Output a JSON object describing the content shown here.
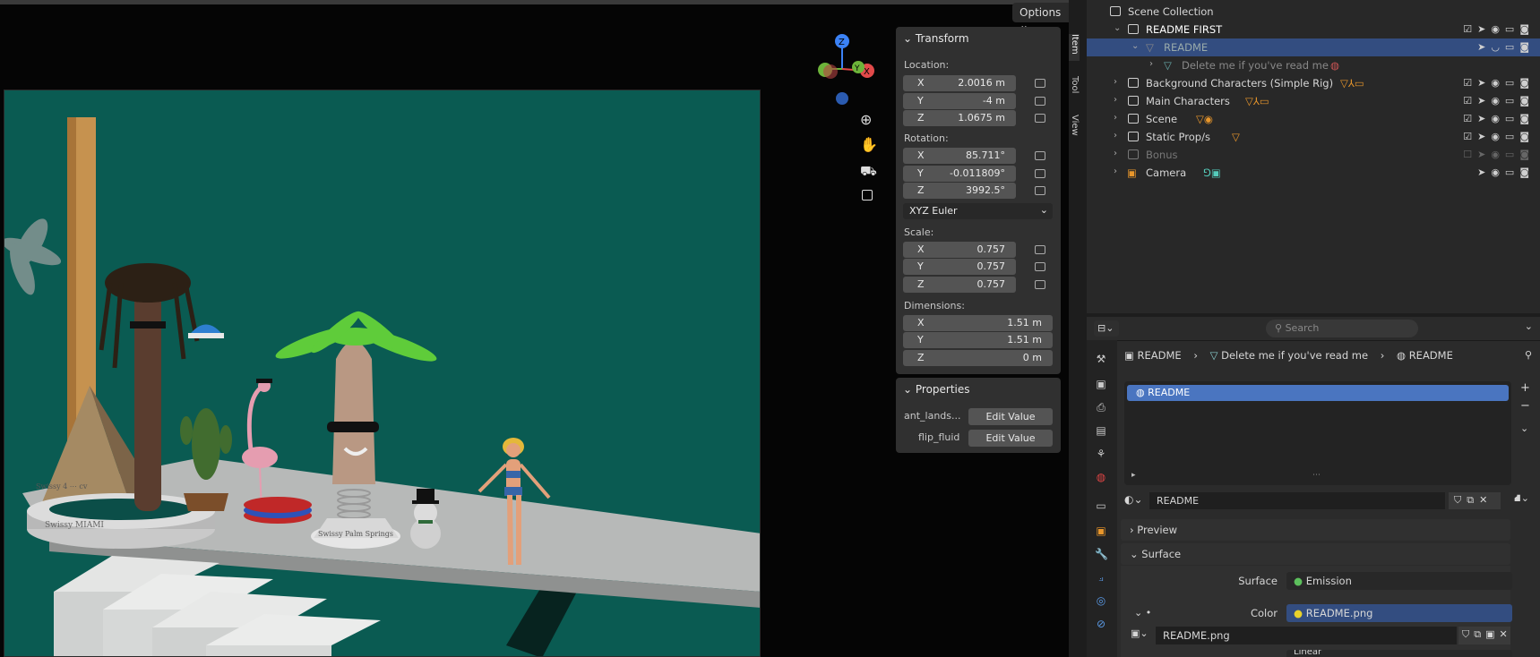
{
  "viewport": {
    "options_label": "Options ⌄",
    "text_art_1": "Swissy 4 ⋯ cv",
    "text_art_2": "Swissy MIAMI",
    "text_art_3": "Swissy Palm Springs",
    "tabs": [
      "Item",
      "Tool",
      "View"
    ]
  },
  "transform": {
    "title": "Transform",
    "location_label": "Location:",
    "location": {
      "x": "2.0016 m",
      "y": "-4 m",
      "z": "1.0675 m"
    },
    "rotation_label": "Rotation:",
    "rotation": {
      "x": "85.711°",
      "y": "-0.011809°",
      "z": "3992.5°"
    },
    "rotation_mode": "XYZ Euler",
    "scale_label": "Scale:",
    "scale": {
      "x": "0.757",
      "y": "0.757",
      "z": "0.757"
    },
    "dimensions_label": "Dimensions:",
    "dimensions": {
      "x": "1.51 m",
      "y": "1.51 m",
      "z": "0 m"
    },
    "axes": {
      "x": "X",
      "y": "Y",
      "z": "Z"
    }
  },
  "properties_panel": {
    "title": "Properties",
    "items": [
      {
        "label": "ant_lands...",
        "button": "Edit Value"
      },
      {
        "label": "flip_fluid",
        "button": "Edit Value"
      }
    ]
  },
  "outliner": {
    "scene_collection": "Scene Collection",
    "rows": [
      {
        "label": "README FIRST"
      },
      {
        "label": "README"
      },
      {
        "label": "Delete me if you've read me"
      },
      {
        "label": "Background Characters (Simple Rig)"
      },
      {
        "label": "Main Characters"
      },
      {
        "label": "Scene"
      },
      {
        "label": "Static Prop/s"
      },
      {
        "label": "Bonus"
      },
      {
        "label": "Camera"
      }
    ],
    "selection_color": "#334d80"
  },
  "properties_editor": {
    "search_placeholder": "Search",
    "breadcrumb": [
      "README",
      "Delete me if you've read me",
      "README"
    ],
    "material_slot": "README",
    "material_name": "README",
    "preview_label": "Preview",
    "surface_label": "Surface",
    "surface_field_label": "Surface",
    "surface_value": "Emission",
    "color_label": "Color",
    "color_value": "README.png",
    "image_name": "README.png",
    "bottom_partial": "Linear"
  }
}
